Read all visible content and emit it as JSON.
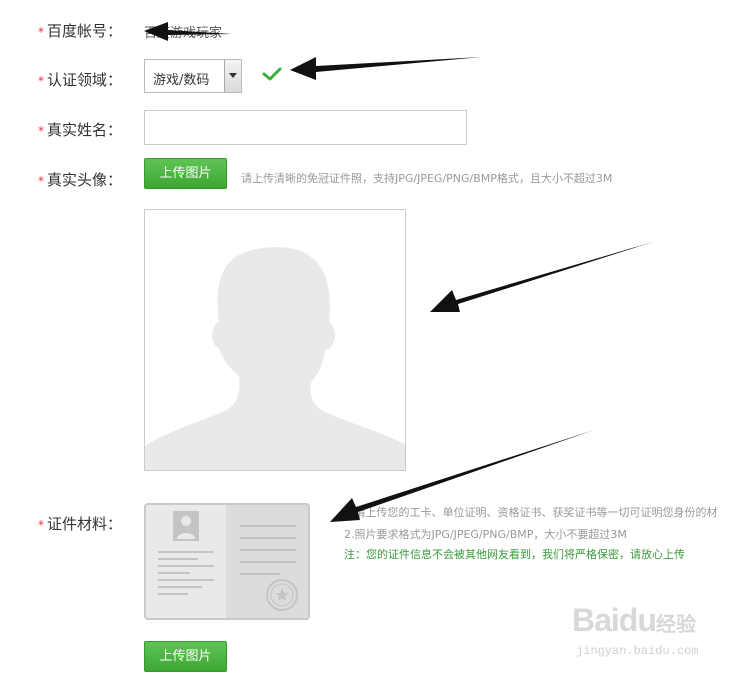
{
  "form": {
    "required_mark": "*",
    "account": {
      "label": "百度帐号：",
      "value": "百度游戏玩家"
    },
    "domain": {
      "label": "认证领域：",
      "selected": "游戏/数码"
    },
    "realname": {
      "label": "真实姓名：",
      "value": ""
    },
    "photo": {
      "label": "真实头像：",
      "upload_label": "上传图片",
      "hint": "请上传清晰的免冠证件照，支持JPG/JPEG/PNG/BMP格式，且大小不超过3M"
    },
    "materials": {
      "label": "证件材料：",
      "note1": "1.请上传您的工卡、单位证明、资格证书、获奖证书等一切可证明您身份的材",
      "note2": "2.照片要求格式为JPG/JPEG/PNG/BMP，大小不要超过3M",
      "note3": "注：您的证件信息不会被其他网友看到，我们将严格保密，请放心上传",
      "upload_label": "上传图片"
    }
  },
  "watermark": {
    "logo": "Baidu",
    "cn": "经验",
    "url": "jingyan.baidu.com"
  },
  "icons": {
    "check": "check-icon",
    "dropdown": "chevron-down-icon"
  },
  "colors": {
    "required": "#e4393c",
    "button": "#4cb541",
    "check": "#3ab03a",
    "note_green": "#3a9a3a"
  }
}
